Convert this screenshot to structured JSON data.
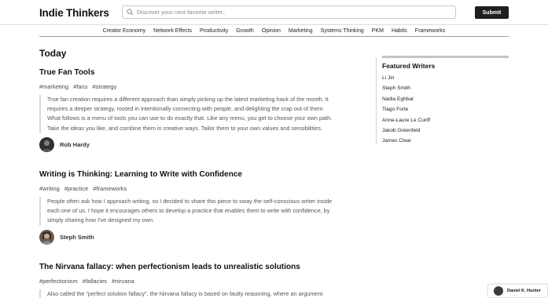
{
  "header": {
    "logo": "Indie Thinkers",
    "search_placeholder": "Discover your next favorite writer..",
    "submit_label": "Submit"
  },
  "nav": {
    "items": [
      "Creator Economy",
      "Network Effects",
      "Productivity",
      "Growth",
      "Opinion",
      "Marketing",
      "Systems Thinking",
      "PKM",
      "Habits",
      "Frameworks"
    ]
  },
  "main": {
    "heading": "Today",
    "posts": [
      {
        "title": "True Fan Tools",
        "tags": [
          "#marketing",
          "#fans",
          "#strategy"
        ],
        "excerpt_lines": [
          "True fan creation requires a different approach than simply picking up the latest marketing hack of the month. It",
          "requires a deeper strategy, rooted in intentionally connecting with people, and delighting the crap out of them.",
          "What follows is a menu of tools you can use to do exactly that. Like any menu, you get to choose your own path.",
          "Take the ideas you like, and combine them in creative ways. Tailor them to your own values and sensibilities."
        ],
        "author": "Rob Hardy"
      },
      {
        "title": "Writing is Thinking: Learning to Write with Confidence",
        "tags": [
          "#writing",
          "#practice",
          "#frameworks"
        ],
        "excerpt_lines": [
          "People often ask how I approach writing, so I decided to share this piece to sway the self-conscious writer inside",
          "each one of us. I hope it encourages others to develop a practice that enables them to write with confidence, by",
          "simply sharing how I've designed my own."
        ],
        "author": "Steph Smith"
      },
      {
        "title": "The Nirvana fallacy: when perfectionism leads to unrealistic solutions",
        "tags": [
          "#perfectionism",
          "#fallacies",
          "#nirvana"
        ],
        "excerpt_lines": [
          "Also called the “perfect solution fallacy”, the Nirvana fallacy is based on faulty reasoning, where an argument"
        ],
        "author": ""
      }
    ]
  },
  "sidebar": {
    "title": "Featured Writers",
    "writers": [
      "Li Jin",
      "Steph Smith",
      "Nadia Eghbal",
      "Tiago Forte",
      "Anne-Laure Le Cunff",
      "Jakob Greenfeld",
      "James Clear"
    ]
  },
  "user": {
    "name": "Daniel K. Hunter"
  },
  "icons": {
    "search": "search-icon"
  },
  "colors": {
    "button_bg": "#1f1f1f",
    "tag_text": "#4a4a4a",
    "excerpt_text": "#555555"
  }
}
